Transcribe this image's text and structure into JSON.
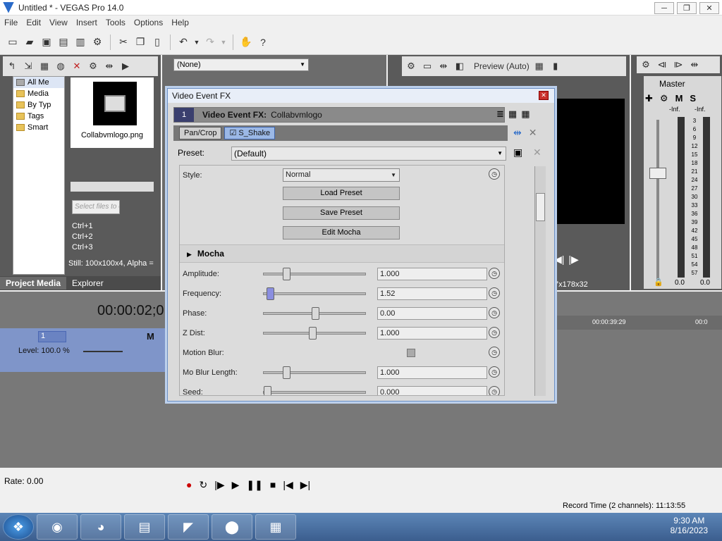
{
  "window": {
    "title": "Untitled * - VEGAS Pro 14.0",
    "min": "─",
    "max": "❐",
    "close": "✕"
  },
  "menu": [
    "File",
    "Edit",
    "View",
    "Insert",
    "Tools",
    "Options",
    "Help"
  ],
  "toolbar_icons": [
    "new-icon",
    "open-icon",
    "save-icon",
    "save-as-icon",
    "render-icon",
    "properties-icon",
    "cut-icon",
    "copy-icon",
    "paste-icon",
    "undo-icon",
    "redo-icon",
    "enable-snapping-icon",
    "help-icon"
  ],
  "explorer": {
    "tree": [
      "All Me",
      "Media",
      "By Typ",
      "Tags",
      "Smart"
    ],
    "media_file": "Collabvmlogo.png",
    "search_placeholder": "Select files to edit tags",
    "shortcuts": [
      "Ctrl+1",
      "Ctrl+2",
      "Ctrl+3"
    ],
    "still_info": "Still: 100x100x4, Alpha =",
    "tabs": [
      "Project Media",
      "Explorer"
    ]
  },
  "plugin_dropdown": "(None)",
  "preview": {
    "mode": "Preview (Auto)",
    "frame_info": "7x178x32"
  },
  "master": {
    "label": "Master",
    "m": "M",
    "s": "S",
    "inf_left": "-Inf.",
    "inf_right": "-Inf.",
    "scale": [
      "3",
      "6",
      "9",
      "12",
      "15",
      "18",
      "21",
      "24",
      "27",
      "30",
      "33",
      "36",
      "39",
      "42",
      "45",
      "48",
      "51",
      "54",
      "57"
    ],
    "val_left": "0.0",
    "val_right": "0.0"
  },
  "timeline": {
    "timecode": "00:00:02;0",
    "ruler_time": "00:00:39:29",
    "ruler_time2": "00:0",
    "track_num": "1",
    "level": "Level: 100.0 %",
    "track_m": "M",
    "rate": "Rate: 0.00",
    "record_time": "Record Time (2 channels): 11:13:55"
  },
  "dialog": {
    "title": "Video Event FX",
    "header_num": "1",
    "header_label": "Video Event FX:",
    "header_media": "Collabvmlogo",
    "chain": [
      "Pan/Crop",
      "S_Shake"
    ],
    "preset_label": "Preset:",
    "preset_value": "(Default)",
    "style_label": "Style:",
    "style_value": "Normal",
    "buttons": [
      "Load Preset",
      "Save Preset",
      "Edit Mocha"
    ],
    "section": "Mocha",
    "params": [
      {
        "label": "Amplitude:",
        "value": "1.000",
        "pos": 0.2
      },
      {
        "label": "Frequency:",
        "value": "1.52",
        "pos": 0.03
      },
      {
        "label": "Phase:",
        "value": "0.00",
        "pos": 0.5
      },
      {
        "label": "Z Dist:",
        "value": "1.000",
        "pos": 0.47
      },
      {
        "label": "Motion Blur:",
        "value": "",
        "pos": null
      },
      {
        "label": "Mo Blur Length:",
        "value": "1.000",
        "pos": 0.2
      },
      {
        "label": "Seed:",
        "value": "0.000",
        "pos": 0.0
      }
    ]
  },
  "taskbar": {
    "time": "9:30 AM",
    "date": "8/16/2023"
  }
}
